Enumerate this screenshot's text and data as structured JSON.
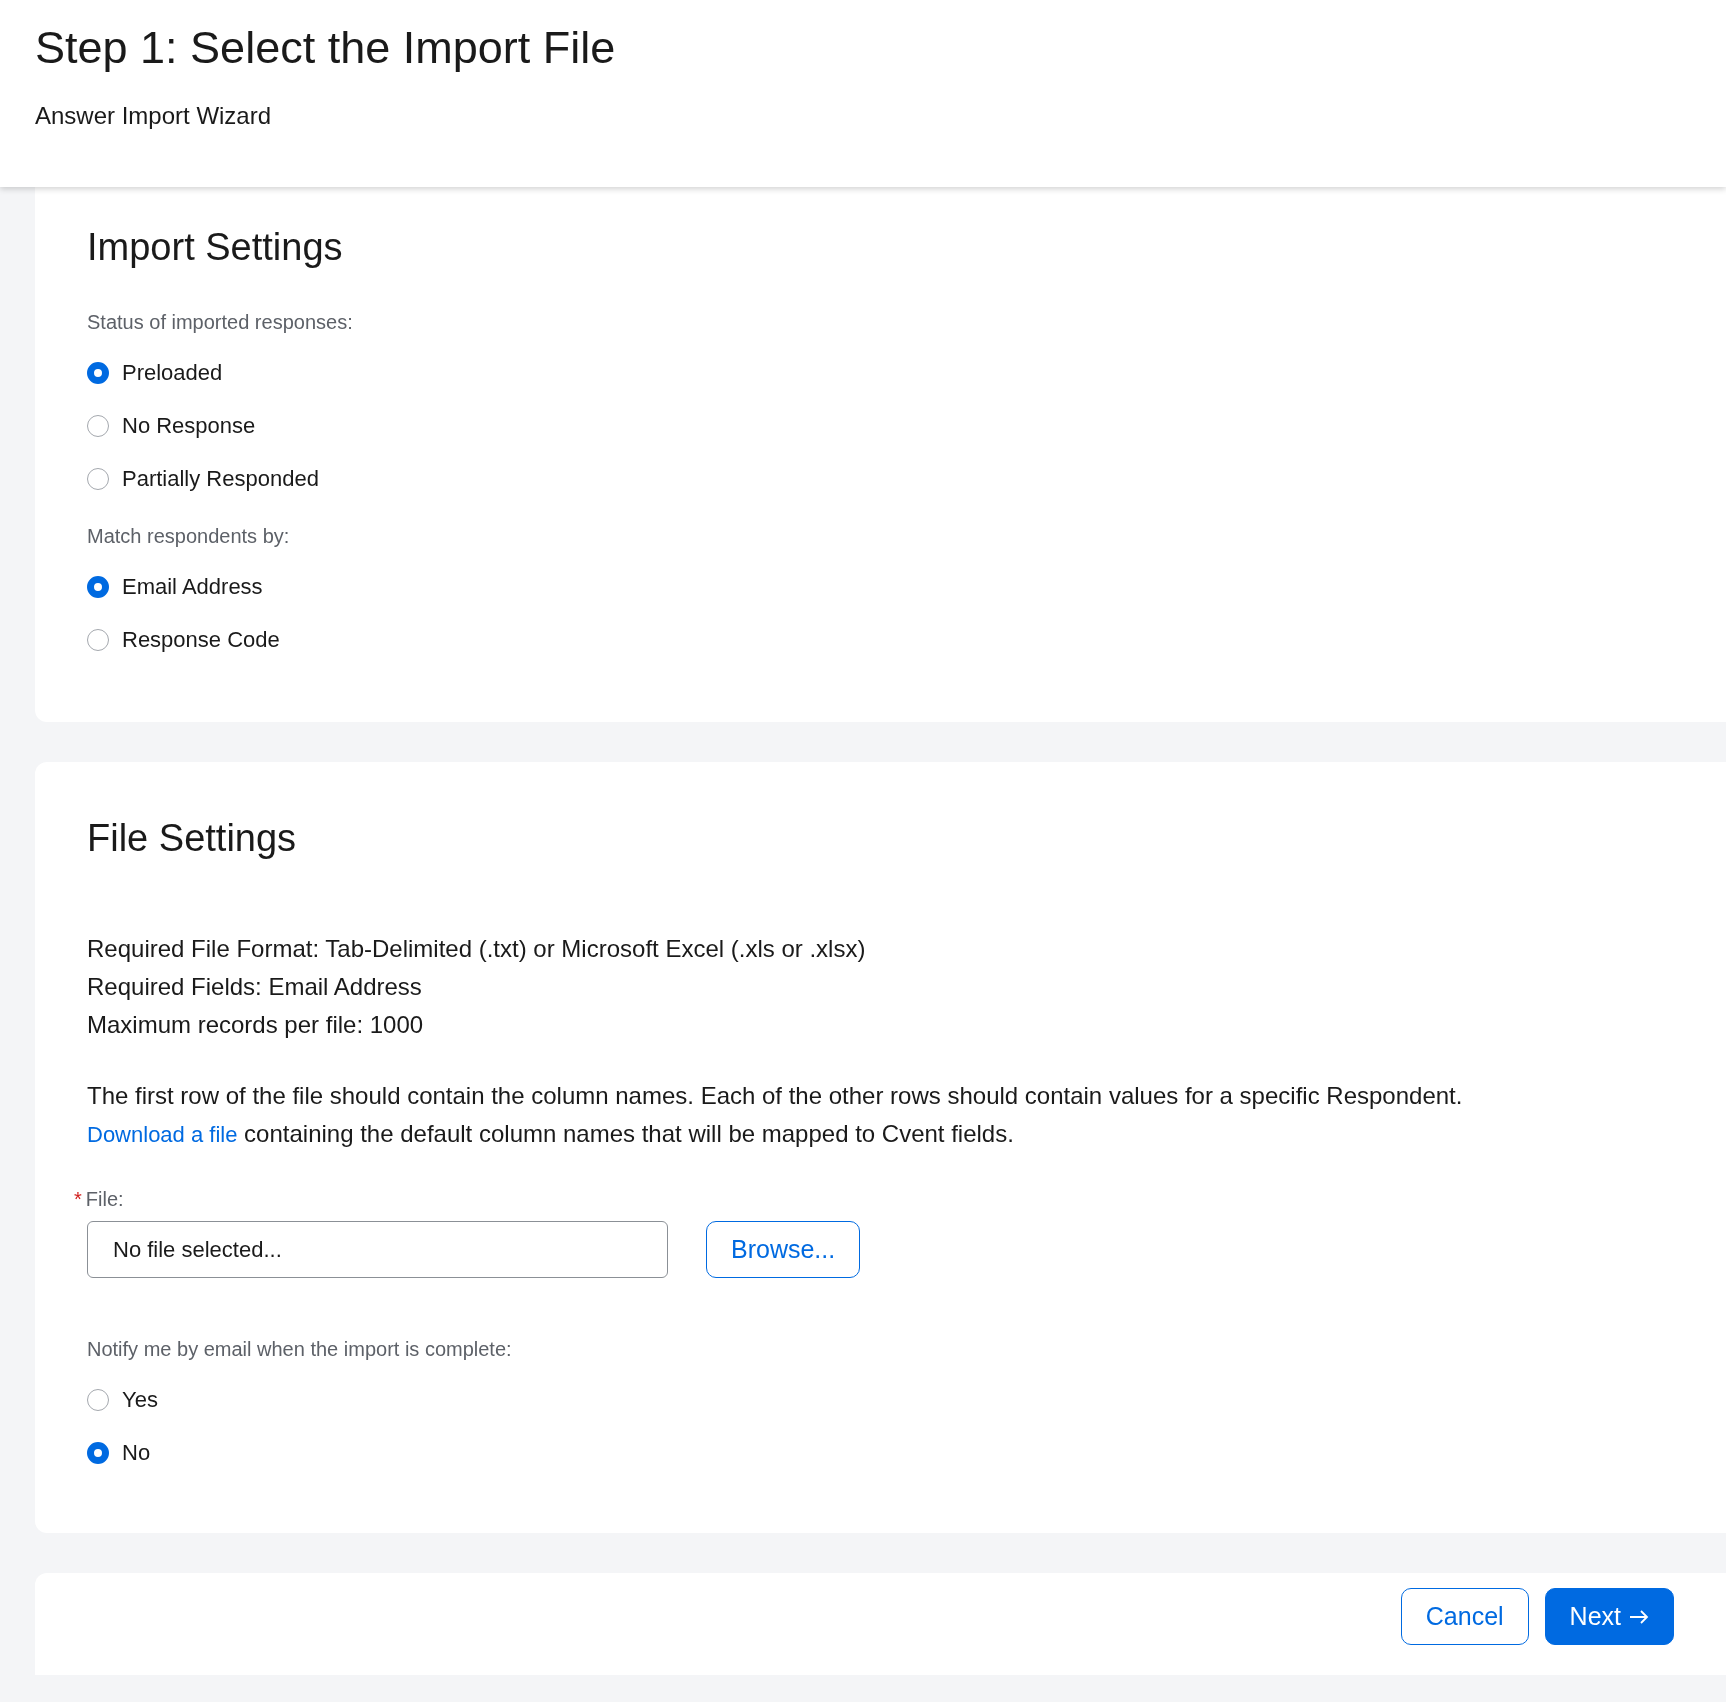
{
  "header": {
    "title": "Step 1: Select the Import File",
    "subtitle": "Answer Import Wizard"
  },
  "import_settings": {
    "title": "Import Settings",
    "groups": [
      {
        "label": "Status of imported responses:",
        "options": [
          {
            "label": "Preloaded",
            "selected": true
          },
          {
            "label": "No Response",
            "selected": false
          },
          {
            "label": "Partially Responded",
            "selected": false
          }
        ]
      },
      {
        "label": "Match respondents by:",
        "options": [
          {
            "label": "Email Address",
            "selected": true
          },
          {
            "label": "Response Code",
            "selected": false
          }
        ]
      }
    ]
  },
  "file_settings": {
    "title": "File Settings",
    "requirements": [
      "Required File Format: Tab-Delimited (.txt) or Microsoft Excel (.xls or .xlsx)",
      "Required Fields: Email Address",
      "Maximum records per file: 1000"
    ],
    "description": "The first row of the file should contain the column names. Each of the other rows should contain values for a specific Respondent.",
    "download_link": "Download a file",
    "download_text": "containing the default column names that will be mapped to Cvent fields.",
    "file_field": {
      "required_mark": "*",
      "label": "File:",
      "placeholder": "No file selected..."
    },
    "browse_button": "Browse...",
    "notify": {
      "label": "Notify me by email when the import is complete:",
      "options": [
        {
          "label": "Yes",
          "selected": false
        },
        {
          "label": "No",
          "selected": true
        }
      ]
    }
  },
  "footer": {
    "buttons": [
      {
        "label": "Cancel",
        "kind": "secondary"
      },
      {
        "label": "Next",
        "kind": "primary"
      }
    ]
  }
}
